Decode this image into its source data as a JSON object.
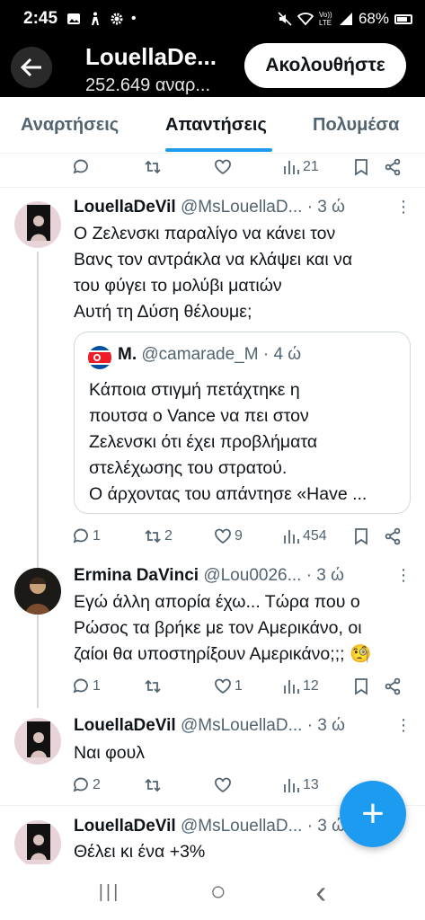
{
  "status_bar": {
    "time": "2:45",
    "battery": "68%",
    "icons": [
      "gallery-icon",
      "accessibility-icon",
      "gear-icon",
      "dot-icon",
      "mute-icon",
      "wifi-icon",
      "volte-icon",
      "signal-icon",
      "battery-icon"
    ],
    "volte": "Vo)) LTE"
  },
  "header": {
    "name": "LouellaDe...",
    "subtitle": "252.649 αναρ...",
    "follow_label": "Ακολουθήστε"
  },
  "tabs": [
    {
      "label": "Αναρτήσεις",
      "active": false
    },
    {
      "label": "Απαντήσεις",
      "active": true
    },
    {
      "label": "Πολυμέσα",
      "active": false
    }
  ],
  "accent": "#1d9bf0",
  "top_actions": {
    "views": "21"
  },
  "tweets": [
    {
      "name": "LouellaDeVil",
      "handle": "@MsLouellaD...",
      "time": "· 3 ώ",
      "text": [
        "Ο Ζελενσκι παραλίγο να κάνει τον",
        "Βανς τον αντράκλα να κλάψει και να",
        "του φύγει το μολύβι ματιών",
        "Αυτή τη Δύση θέλουμε;"
      ],
      "quote": {
        "name": "M.",
        "handle": "@camarade_M",
        "time": "· 4 ώ",
        "text": [
          "Κάποια στιγμή πετάχτηκε η",
          "πουτσα ο Vance να πει στον",
          "Ζελενσκι ότι έχει προβλήματα",
          "στελέχωσης του στρατού.",
          "Ο άρχοντας του απάντησε «Have ..."
        ]
      },
      "replies": "1",
      "reposts": "2",
      "likes": "9",
      "views": "454"
    },
    {
      "name": "Ermina DaVinci",
      "handle": "@Lou0026...",
      "time": "· 3 ώ",
      "text": [
        "Εγώ άλλη απορία έχω... Τώρα που ο",
        "Ρώσος τα βρήκε με τον Αμερικάνο, οι",
        "ζαίοι θα υποστηρίξουν Αμερικάνο;;; 🧐"
      ],
      "replies": "1",
      "reposts": "",
      "likes": "1",
      "views": "12"
    },
    {
      "name": "LouellaDeVil",
      "handle": "@MsLouellaD...",
      "time": "· 3 ώ",
      "text": [
        "Ναι φουλ"
      ],
      "replies": "2",
      "reposts": "",
      "likes": "",
      "views": "13"
    },
    {
      "name": "LouellaDeVil",
      "handle": "@MsLouellaD...",
      "time": "· 3 ώ",
      "text": [
        "Θέλει κι ένα +3%"
      ]
    }
  ],
  "fab_label": "+",
  "navbar": {
    "recent": "|||",
    "home": "○",
    "back": "‹"
  }
}
